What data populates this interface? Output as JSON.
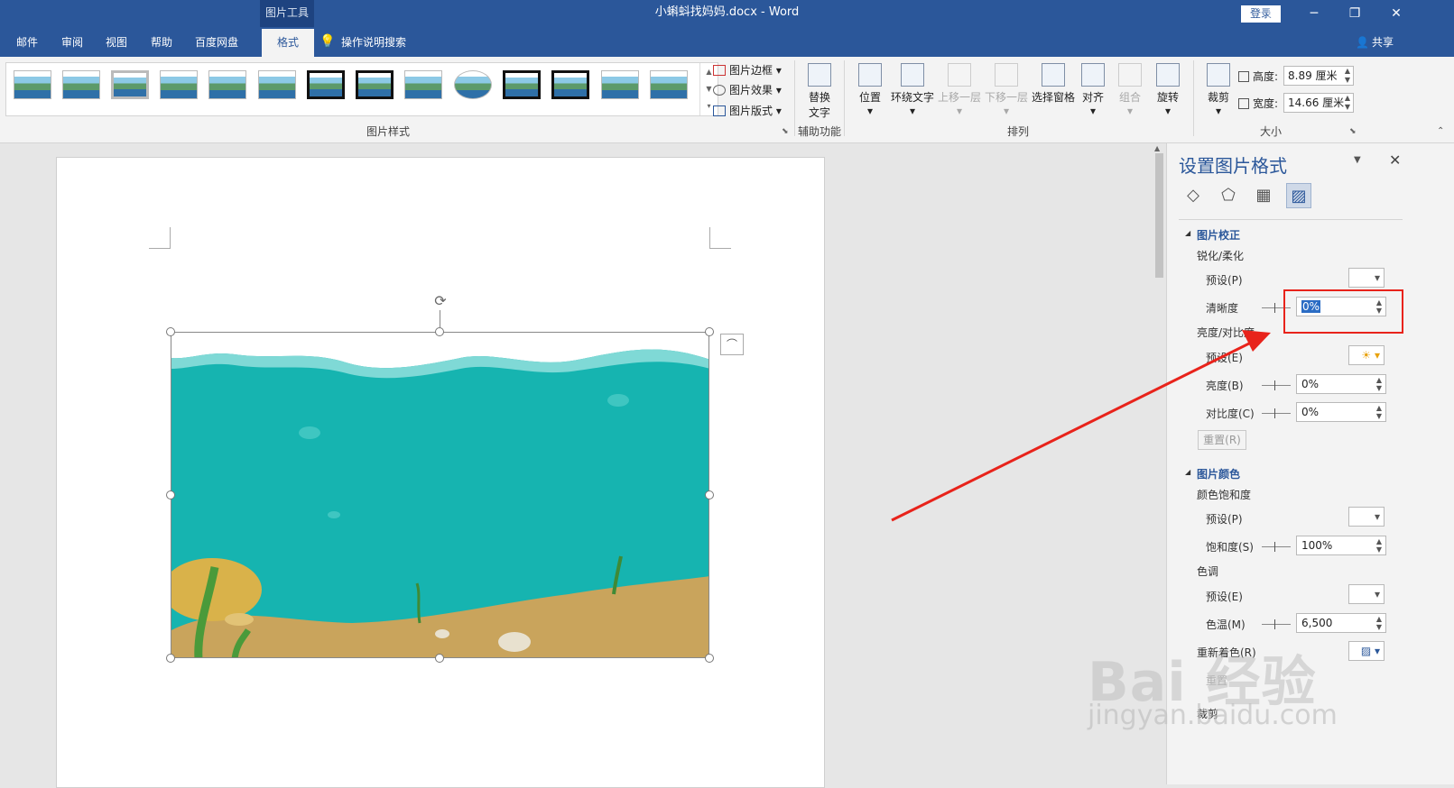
{
  "titlebar": {
    "context_tab_header": "图片工具",
    "doc_title": "小蝌蚪找妈妈.docx - Word",
    "login": "登录",
    "share": "共享"
  },
  "tabs": [
    "邮件",
    "审阅",
    "视图",
    "帮助",
    "百度网盘",
    "格式"
  ],
  "active_tab": "格式",
  "tell_me": "操作说明搜索",
  "ribbon": {
    "picture_styles_group": "图片样式",
    "picture_border": "图片边框",
    "picture_effects": "图片效果",
    "picture_layout": "图片版式",
    "alt_text": "替换\n文字",
    "accessibility_group": "辅助功能",
    "position": "位置",
    "wrap_text": "环绕文字",
    "bring_forward": "上移一层",
    "send_backward": "下移一层",
    "selection_pane": "选择窗格",
    "align": "对齐",
    "group": "组合",
    "rotate": "旋转",
    "arrange_group": "排列",
    "crop": "裁剪",
    "height_label": "高度:",
    "height_value": "8.89 厘米",
    "width_label": "宽度:",
    "width_value": "14.66 厘米",
    "size_group": "大小"
  },
  "pane": {
    "title": "设置图片格式",
    "section_correction": "图片校正",
    "sharpen_soften": "锐化/柔化",
    "preset": "预设(P)",
    "sharpness": "清晰度",
    "sharpness_value": "0%",
    "brightness_contrast": "亮度/对比度",
    "preset2": "预设(E)",
    "brightness": "亮度(B)",
    "brightness_value": "0%",
    "contrast": "对比度(C)",
    "contrast_value": "0%",
    "reset": "重置(R)",
    "section_color": "图片颜色",
    "color_saturation": "颜色饱和度",
    "preset3": "预设(P)",
    "saturation": "饱和度(S)",
    "saturation_value": "100%",
    "color_tone": "色调",
    "preset4": "预设(E)",
    "temperature": "色温(M)",
    "temperature_value": "6,500",
    "recolor": "重新着色(R)",
    "reset2": "重置",
    "crop": "裁剪"
  },
  "watermark": {
    "brand": "Bai 经验",
    "site": "jingyan.baidu.com"
  },
  "colors": {
    "accent": "#2b579a",
    "highlight": "#e8231b",
    "water": "#16b4b0",
    "sand": "#c9a45c"
  }
}
